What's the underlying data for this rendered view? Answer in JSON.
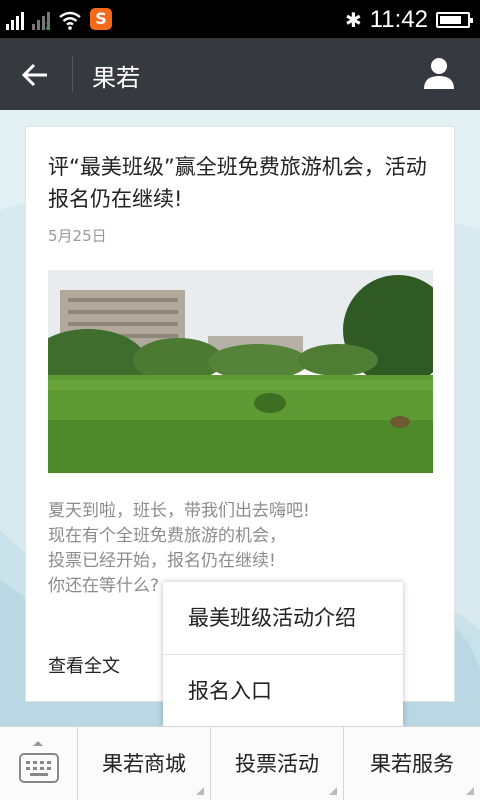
{
  "status_bar": {
    "time": "11:42",
    "battery_level": 0.8,
    "sim2_label": "2",
    "app_badge": "S",
    "icons": [
      "signal-icon",
      "signal-2-icon",
      "wifi-icon",
      "sogou-icon",
      "bluetooth-icon",
      "battery-icon"
    ]
  },
  "header": {
    "title": "果若",
    "back_icon": "arrow-left-icon",
    "profile_icon": "user-icon"
  },
  "article": {
    "title": "评“最美班级”赢全班免费旅游机会，活动报名仍在继续!",
    "date": "5月25日",
    "description": [
      "夏天到啦，班长，带我们出去嗨吧!",
      "现在有个全班免费旅游的机会，",
      "投票已经开始，报名仍在继续!",
      "你还在等什么?"
    ],
    "read_more": "查看全文"
  },
  "popup_menu": {
    "items": [
      "最美班级活动介绍",
      "报名入口"
    ]
  },
  "bottom_menu": {
    "keyboard_icon": "keyboard-icon",
    "items": [
      "果若商城",
      "投票活动",
      "果若服务"
    ]
  }
}
